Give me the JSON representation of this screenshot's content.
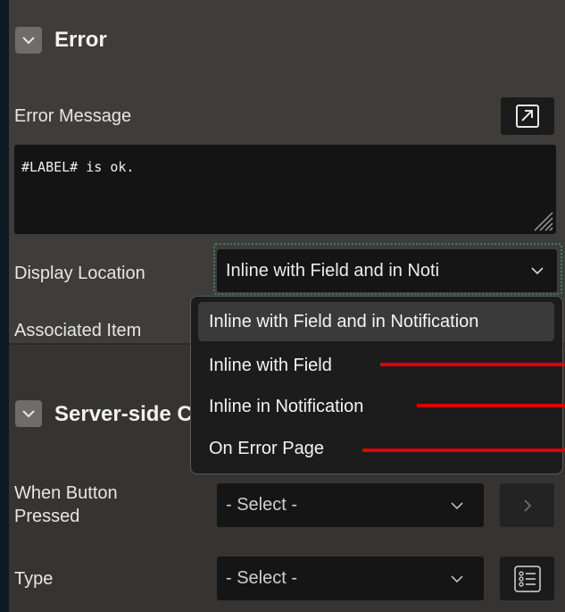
{
  "error_section": {
    "title": "Error",
    "error_message_label": "Error Message",
    "error_message_value": "#LABEL# is ok.",
    "display_location_label": "Display Location",
    "display_location_value": "Inline with Field and in Noti",
    "associated_item_label": "Associated Item"
  },
  "dropdown": {
    "options": [
      "Inline with Field and in Notification",
      "Inline with Field",
      "Inline in Notification",
      "On Error Page"
    ],
    "selected_index": 0,
    "annotation_color": "#e00000"
  },
  "server_side_section": {
    "title": "Server-side C",
    "when_button_pressed_label": "When Button Pressed",
    "when_button_pressed_value": "- Select -",
    "type_label": "Type",
    "type_value": "- Select -"
  }
}
